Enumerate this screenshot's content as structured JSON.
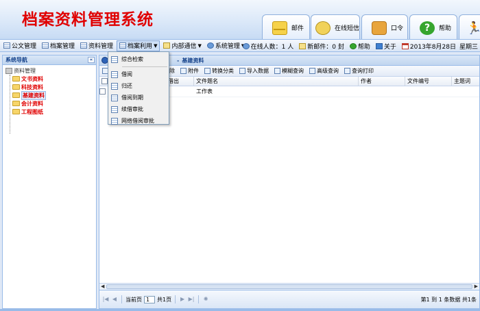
{
  "header": {
    "title": "档案资料管理系统",
    "tabs": [
      {
        "label": "邮件",
        "icon": "envelope-icon"
      },
      {
        "label": "在线短信",
        "icon": "chat-icon"
      },
      {
        "label": "口令",
        "icon": "lock-icon"
      },
      {
        "label": "帮助",
        "icon": "help-icon"
      },
      {
        "label": "",
        "icon": "running-man-icon"
      }
    ]
  },
  "toolbar": {
    "menus": [
      "公文管理",
      "档案管理",
      "资料管理",
      "档案利用",
      "内部通信",
      "系统管理"
    ],
    "online": "在线人数：1 人",
    "new_mail": "新邮件：0 封",
    "help": "帮助",
    "about": "关于",
    "date": "2013年8月28日",
    "weekday": "星期三"
  },
  "dropdown": {
    "items": [
      "综合检索",
      "借阅",
      "归还",
      "借阅到期",
      "续借审批",
      "网络借阅审批"
    ]
  },
  "sidebar": {
    "title": "系统导航",
    "collapse": "«",
    "root": "资料管理",
    "items": [
      "文书资料",
      "科技资料",
      "基建资料",
      "会计资料",
      "工程图纸"
    ]
  },
  "main": {
    "title": "基建资料",
    "title_prefix": "-",
    "actions": [
      "删除",
      "附件",
      "转换分类",
      "导入数据",
      "模糊查询",
      "高级查询",
      "查询打印"
    ],
    "columns": [
      "",
      "借出",
      "文件题名",
      "作者",
      "文件编号",
      "主题词"
    ],
    "rows": [
      {
        "lend": "",
        "title": "工作表",
        "author": "",
        "number": "",
        "keywords": ""
      }
    ],
    "pager": {
      "page_label": "当前页",
      "page_value": "1",
      "total": "共1页",
      "info": "第1 到  1 条数据  共1条"
    }
  },
  "colors": {
    "title_red": "#e00000",
    "header_blue": "#15428b",
    "border_blue": "#99bbe8"
  }
}
